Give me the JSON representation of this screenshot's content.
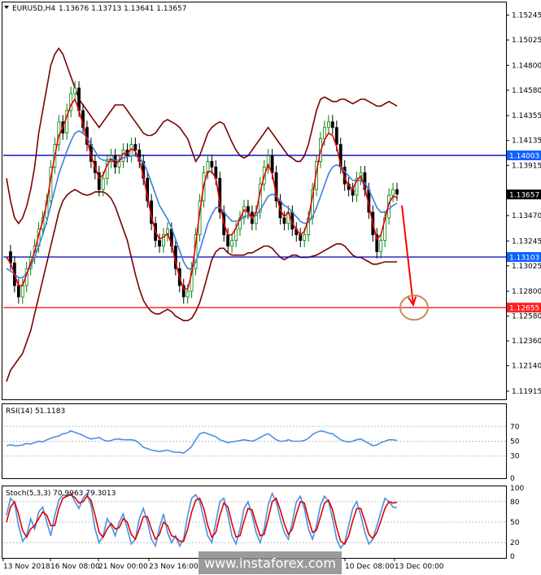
{
  "header": {
    "symbol": "EURUSD,H4",
    "ohlc": "1.13676 1.13713 1.13641 1.13657"
  },
  "rsi_title": "RSI(14) 51.1183",
  "stoch_title": "Stoch(5,3,3) 70.9963 79.3013",
  "watermark": "www.instaforex.com",
  "colors": {
    "bullish": "#008000",
    "bearish": "#000000",
    "ma_fast": "#e00000",
    "ma_slow": "#3a7fdc",
    "bands": "#7b0000",
    "level_line": "#0000c0",
    "target_line": "#ff0000",
    "rsi_line": "#4a90e2",
    "stoch_main": "#4a90e2",
    "stoch_signal": "#e00000",
    "price_marker": "#000000",
    "level_marker": "#1060ff",
    "target_marker": "#ff2020",
    "circle": "#c98a5a"
  },
  "chart_data": [
    {
      "type": "line",
      "title": "EURUSD,H4",
      "y_ticks": [
        "1.15245",
        "1.15025",
        "1.14800",
        "1.14580",
        "1.14355",
        "1.14135",
        "1.13915",
        "1.13470",
        "1.13245",
        "1.13025",
        "1.12800",
        "1.12580",
        "1.12360",
        "1.12140",
        "1.11915"
      ],
      "ylim": [
        1.1185,
        1.1535
      ],
      "x_ticks": [
        "13 Nov 2018",
        "16 Nov 08:00",
        "21 Nov 00:00",
        "23 Nov 16:00",
        "10 Dec 08:00",
        "13 Dec 00:00"
      ],
      "current_price": {
        "label": "1.13657",
        "value": 1.13657
      },
      "levels": [
        {
          "label": "1.14003",
          "value": 1.14003,
          "kind": "resistance"
        },
        {
          "label": "1.13103",
          "value": 1.13103,
          "kind": "support"
        },
        {
          "label": "1.12655",
          "value": 1.12655,
          "kind": "target"
        }
      ],
      "forecast_arrow": {
        "from": 1.1356,
        "to": 1.1268
      },
      "close": [
        1.1315,
        1.1305,
        1.1285,
        1.1275,
        1.1285,
        1.13,
        1.131,
        1.132,
        1.1335,
        1.1345,
        1.136,
        1.139,
        1.141,
        1.143,
        1.142,
        1.144,
        1.1455,
        1.146,
        1.144,
        1.1425,
        1.141,
        1.1395,
        1.1385,
        1.137,
        1.138,
        1.1395,
        1.14,
        1.139,
        1.1395,
        1.1405,
        1.14,
        1.141,
        1.1405,
        1.1395,
        1.138,
        1.136,
        1.134,
        1.1325,
        1.132,
        1.133,
        1.1335,
        1.132,
        1.13,
        1.1285,
        1.1275,
        1.128,
        1.13,
        1.133,
        1.136,
        1.1385,
        1.1395,
        1.139,
        1.138,
        1.135,
        1.133,
        1.132,
        1.1325,
        1.1335,
        1.1345,
        1.1355,
        1.135,
        1.134,
        1.135,
        1.1375,
        1.139,
        1.14,
        1.1385,
        1.136,
        1.1345,
        1.134,
        1.135,
        1.1335,
        1.133,
        1.1325,
        1.133,
        1.1345,
        1.137,
        1.1395,
        1.1415,
        1.1425,
        1.143,
        1.1425,
        1.141,
        1.139,
        1.1375,
        1.137,
        1.1365,
        1.138,
        1.1385,
        1.137,
        1.135,
        1.133,
        1.1315,
        1.1325,
        1.1345,
        1.1365,
        1.137,
        1.1366
      ],
      "ma_fast": [
        1.131,
        1.1305,
        1.1295,
        1.1285,
        1.1285,
        1.1295,
        1.1305,
        1.1315,
        1.133,
        1.1342,
        1.1358,
        1.138,
        1.14,
        1.1418,
        1.1425,
        1.1435,
        1.1445,
        1.145,
        1.144,
        1.1428,
        1.1414,
        1.14,
        1.139,
        1.138,
        1.1383,
        1.1392,
        1.1397,
        1.1393,
        1.1395,
        1.1402,
        1.1402,
        1.1406,
        1.1404,
        1.1396,
        1.1382,
        1.1364,
        1.1346,
        1.1333,
        1.1326,
        1.1328,
        1.1331,
        1.1322,
        1.1306,
        1.1292,
        1.1282,
        1.1282,
        1.1296,
        1.1322,
        1.135,
        1.1374,
        1.1386,
        1.1386,
        1.138,
        1.1358,
        1.134,
        1.133,
        1.133,
        1.1336,
        1.1344,
        1.1352,
        1.135,
        1.1344,
        1.135,
        1.1368,
        1.1382,
        1.1392,
        1.1384,
        1.1366,
        1.1352,
        1.1346,
        1.135,
        1.134,
        1.1335,
        1.133,
        1.1333,
        1.1344,
        1.1364,
        1.1386,
        1.1404,
        1.1414,
        1.142,
        1.1418,
        1.1408,
        1.1392,
        1.138,
        1.1374,
        1.137,
        1.1378,
        1.1382,
        1.1372,
        1.1356,
        1.134,
        1.1326,
        1.133,
        1.1344,
        1.1358,
        1.1364,
        1.1363
      ],
      "ma_slow": [
        1.13,
        1.1298,
        1.1295,
        1.1292,
        1.1292,
        1.1296,
        1.1302,
        1.131,
        1.132,
        1.133,
        1.1342,
        1.1356,
        1.137,
        1.1384,
        1.1394,
        1.1404,
        1.1413,
        1.142,
        1.1422,
        1.142,
        1.1416,
        1.141,
        1.1404,
        1.1398,
        1.1396,
        1.1396,
        1.1397,
        1.1396,
        1.1396,
        1.1398,
        1.1399,
        1.14,
        1.14,
        1.1398,
        1.1394,
        1.1386,
        1.1376,
        1.1366,
        1.1356,
        1.135,
        1.1344,
        1.1336,
        1.1326,
        1.1316,
        1.1306,
        1.13,
        1.13,
        1.1306,
        1.1316,
        1.1328,
        1.134,
        1.1348,
        1.1354,
        1.1354,
        1.135,
        1.1346,
        1.1342,
        1.1342,
        1.1343,
        1.1346,
        1.1347,
        1.1346,
        1.1347,
        1.1352,
        1.1358,
        1.1364,
        1.1366,
        1.1364,
        1.136,
        1.1356,
        1.1354,
        1.135,
        1.1346,
        1.1342,
        1.134,
        1.1341,
        1.1346,
        1.1354,
        1.1364,
        1.1374,
        1.1384,
        1.139,
        1.1392,
        1.139,
        1.1386,
        1.1382,
        1.1378,
        1.1378,
        1.1378,
        1.1376,
        1.137,
        1.1362,
        1.1354,
        1.135,
        1.135,
        1.1353,
        1.1356,
        1.1358
      ],
      "band_upper": [
        1.138,
        1.136,
        1.1345,
        1.134,
        1.1345,
        1.1355,
        1.137,
        1.139,
        1.142,
        1.144,
        1.146,
        1.148,
        1.149,
        1.1495,
        1.149,
        1.148,
        1.147,
        1.146,
        1.145,
        1.1445,
        1.144,
        1.1435,
        1.143,
        1.1425,
        1.143,
        1.1435,
        1.144,
        1.1445,
        1.1445,
        1.1445,
        1.144,
        1.1435,
        1.143,
        1.1425,
        1.142,
        1.1418,
        1.1418,
        1.142,
        1.1425,
        1.143,
        1.1432,
        1.143,
        1.1428,
        1.1425,
        1.142,
        1.1415,
        1.1405,
        1.1395,
        1.14,
        1.141,
        1.142,
        1.1425,
        1.1428,
        1.143,
        1.1428,
        1.142,
        1.1412,
        1.1405,
        1.14,
        1.1398,
        1.14,
        1.1405,
        1.141,
        1.1415,
        1.142,
        1.1425,
        1.142,
        1.1415,
        1.141,
        1.1405,
        1.14,
        1.1398,
        1.1395,
        1.1395,
        1.14,
        1.141,
        1.1425,
        1.144,
        1.145,
        1.1452,
        1.145,
        1.1448,
        1.1448,
        1.145,
        1.145,
        1.1448,
        1.1446,
        1.1448,
        1.145,
        1.145,
        1.1448,
        1.1446,
        1.1444,
        1.1444,
        1.1446,
        1.1448,
        1.1446,
        1.1444
      ],
      "band_lower": [
        1.12,
        1.121,
        1.1215,
        1.122,
        1.1225,
        1.1235,
        1.1245,
        1.126,
        1.1275,
        1.129,
        1.1305,
        1.132,
        1.1335,
        1.135,
        1.136,
        1.1365,
        1.1368,
        1.137,
        1.1368,
        1.1366,
        1.1365,
        1.1366,
        1.1368,
        1.1368,
        1.1368,
        1.1366,
        1.1362,
        1.1355,
        1.1345,
        1.1335,
        1.1325,
        1.131,
        1.1295,
        1.1282,
        1.1272,
        1.1266,
        1.1262,
        1.126,
        1.126,
        1.1262,
        1.1264,
        1.1262,
        1.1258,
        1.1256,
        1.1254,
        1.1254,
        1.1256,
        1.1262,
        1.127,
        1.1282,
        1.1295,
        1.1308,
        1.1315,
        1.1318,
        1.1318,
        1.1314,
        1.1312,
        1.1312,
        1.1312,
        1.1312,
        1.1314,
        1.1314,
        1.1316,
        1.1318,
        1.132,
        1.132,
        1.1318,
        1.1314,
        1.131,
        1.1308,
        1.131,
        1.1312,
        1.1312,
        1.131,
        1.131,
        1.131,
        1.1311,
        1.1312,
        1.1314,
        1.1316,
        1.1318,
        1.132,
        1.1322,
        1.1322,
        1.132,
        1.1316,
        1.1312,
        1.131,
        1.131,
        1.1308,
        1.1306,
        1.1304,
        1.1304,
        1.1305,
        1.1306,
        1.1306,
        1.1306,
        1.1306
      ]
    },
    {
      "type": "line",
      "title": "RSI(14) 51.1183",
      "y_ticks": [
        "70",
        "50",
        "30",
        "0"
      ],
      "ylim": [
        0,
        100
      ],
      "values": [
        44,
        45,
        44,
        44,
        45,
        47,
        46,
        48,
        50,
        49,
        52,
        54,
        56,
        57,
        60,
        61,
        64,
        62,
        60,
        58,
        55,
        53,
        54,
        55,
        52,
        50,
        51,
        53,
        53,
        52,
        52,
        52,
        51,
        47,
        42,
        40,
        38,
        37,
        36,
        37,
        38,
        36,
        35,
        35,
        34,
        38,
        43,
        52,
        60,
        62,
        60,
        58,
        56,
        52,
        50,
        48,
        49,
        50,
        51,
        52,
        51,
        50,
        52,
        55,
        58,
        60,
        56,
        52,
        50,
        50,
        52,
        50,
        50,
        50,
        51,
        54,
        59,
        62,
        64,
        63,
        61,
        60,
        56,
        52,
        50,
        49,
        50,
        52,
        53,
        50,
        47,
        44,
        45,
        48,
        50,
        52,
        52,
        51
      ]
    },
    {
      "type": "line",
      "title": "Stoch(5,3,3) 70.9963 79.3013",
      "y_ticks": [
        "100",
        "80",
        "50",
        "20",
        "0"
      ],
      "ylim": [
        0,
        100
      ],
      "main": [
        60,
        85,
        78,
        45,
        22,
        30,
        55,
        40,
        65,
        72,
        50,
        30,
        60,
        82,
        90,
        88,
        92,
        80,
        70,
        85,
        92,
        75,
        40,
        20,
        30,
        55,
        45,
        30,
        50,
        62,
        40,
        18,
        25,
        55,
        70,
        50,
        25,
        15,
        42,
        62,
        35,
        20,
        30,
        15,
        25,
        60,
        85,
        90,
        80,
        55,
        30,
        20,
        50,
        80,
        85,
        60,
        30,
        18,
        40,
        70,
        80,
        60,
        35,
        20,
        40,
        75,
        92,
        80,
        55,
        35,
        25,
        50,
        80,
        88,
        70,
        40,
        25,
        45,
        75,
        88,
        80,
        55,
        25,
        12,
        20,
        45,
        70,
        80,
        60,
        35,
        18,
        25,
        45,
        65,
        85,
        80,
        72,
        71
      ],
      "signal": [
        50,
        72,
        80,
        62,
        38,
        28,
        40,
        45,
        55,
        65,
        60,
        45,
        45,
        70,
        85,
        88,
        90,
        86,
        78,
        80,
        88,
        82,
        60,
        35,
        28,
        40,
        48,
        40,
        42,
        55,
        50,
        32,
        25,
        40,
        58,
        58,
        40,
        25,
        32,
        50,
        45,
        30,
        28,
        22,
        22,
        40,
        65,
        82,
        85,
        70,
        45,
        28,
        35,
        60,
        78,
        72,
        48,
        28,
        30,
        52,
        70,
        68,
        48,
        30,
        32,
        55,
        80,
        85,
        68,
        48,
        32,
        40,
        62,
        80,
        78,
        55,
        35,
        38,
        58,
        78,
        82,
        68,
        42,
        22,
        18,
        30,
        52,
        70,
        70,
        52,
        32,
        26,
        35,
        52,
        70,
        80,
        78,
        79
      ]
    }
  ]
}
